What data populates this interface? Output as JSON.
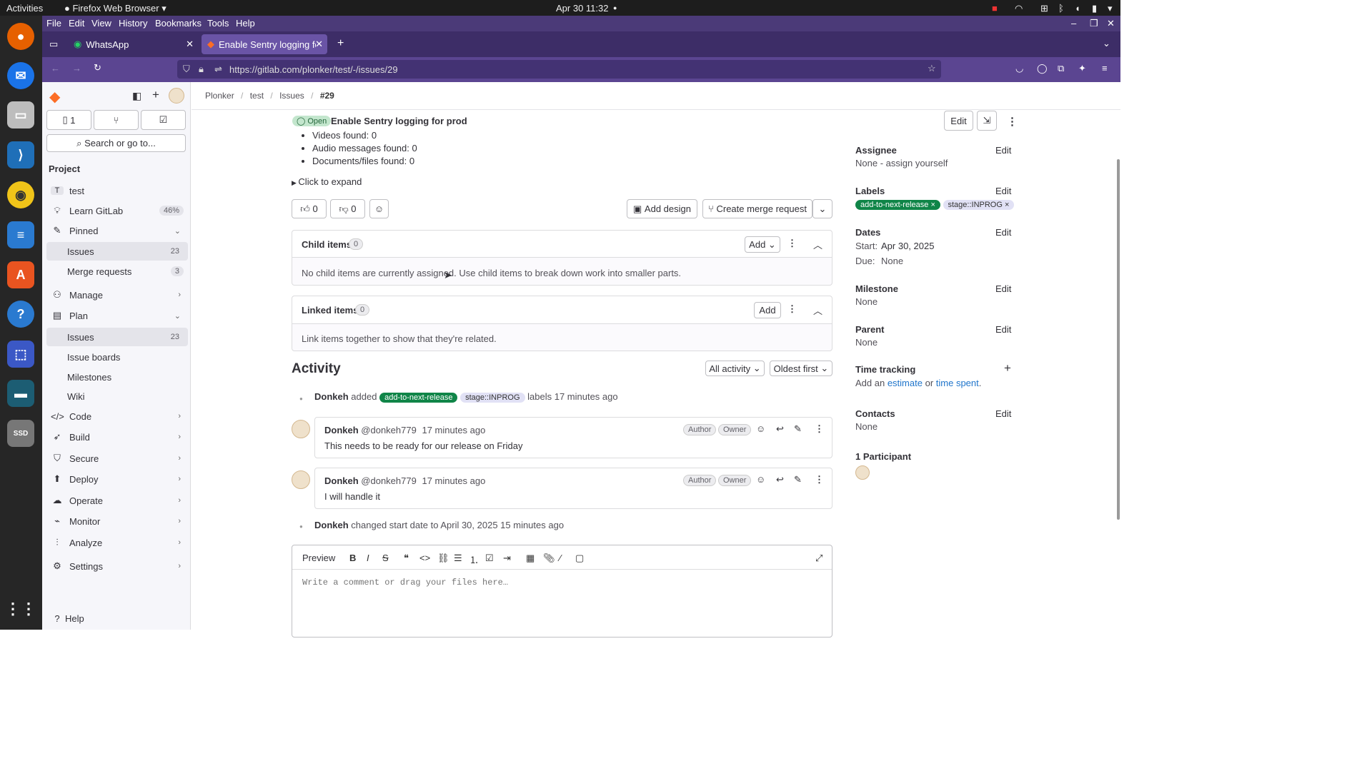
{
  "system": {
    "activities": "Activities",
    "app_name": "Firefox Web Browser",
    "clock": "Apr 30  11:32"
  },
  "dock": {
    "items": [
      "firefox-icon",
      "thunderbird-icon",
      "files-icon",
      "vscode-icon",
      "rhythmbox-icon",
      "writer-icon",
      "app-center-icon",
      "help-icon",
      "screenshot-icon",
      "terminal-icon",
      "ssd-icon",
      "app-grid-icon"
    ],
    "ssd_label": "SSD"
  },
  "firefox": {
    "menu": [
      "File",
      "Edit",
      "View",
      "History",
      "Bookmarks",
      "Tools",
      "Help"
    ],
    "tabs": [
      {
        "title": "WhatsApp"
      },
      {
        "title": "Enable Sentry logging for"
      }
    ],
    "url": "https://gitlab.com/plonker/test/-/issues/29"
  },
  "sidebar": {
    "todo_count": "1",
    "search_label": "Search or go to...",
    "section": "Project",
    "project_letter": "T",
    "project_name": "test",
    "learn_label": "Learn GitLab",
    "learn_progress": "46%",
    "pinned_label": "Pinned",
    "pinned_items": [
      {
        "label": "Issues",
        "count": "23"
      },
      {
        "label": "Merge requests",
        "count": "3"
      }
    ],
    "manage_label": "Manage",
    "plan_label": "Plan",
    "plan_items": [
      {
        "label": "Issues",
        "count": "23"
      },
      {
        "label": "Issue boards"
      },
      {
        "label": "Milestones"
      },
      {
        "label": "Wiki"
      }
    ],
    "groups": [
      "Code",
      "Build",
      "Secure",
      "Deploy",
      "Operate",
      "Monitor",
      "Analyze"
    ],
    "settings_label": "Settings",
    "help_label": "Help"
  },
  "breadcrumb": [
    "Plonker",
    "test",
    "Issues",
    "#29"
  ],
  "issue": {
    "status": "Open",
    "title": "Enable Sentry logging for prod",
    "edit_label": "Edit",
    "list_items": [
      "Videos found: 0",
      "Audio messages found: 0",
      "Documents/files found: 0"
    ],
    "expand_label": "Click to expand",
    "thumbs_up": "0",
    "thumbs_down": "0",
    "add_design": "Add design",
    "create_mr": "Create merge request"
  },
  "child_items": {
    "title": "Child items",
    "count": "0",
    "add": "Add",
    "empty": "No child items are currently assigned. Use child items to break down work into smaller parts."
  },
  "linked_items": {
    "title": "Linked items",
    "count": "0",
    "add": "Add",
    "empty": "Link items together to show that they're related."
  },
  "activity": {
    "title": "Activity",
    "filter": "All activity",
    "sort": "Oldest first",
    "event1": {
      "user": "Donkeh",
      "verb": "added",
      "label1": "add-to-next-release",
      "label2": "stage::INPROG",
      "tail": "labels 17 minutes ago"
    },
    "notes": [
      {
        "user": "Donkeh",
        "handle": "@donkeh779",
        "time": "17 minutes ago",
        "role1": "Author",
        "role2": "Owner",
        "body": "This needs to be ready for our release on Friday"
      },
      {
        "user": "Donkeh",
        "handle": "@donkeh779",
        "time": "17 minutes ago",
        "role1": "Author",
        "role2": "Owner",
        "body": "I will handle it"
      }
    ],
    "event2": {
      "user": "Donkeh",
      "text": "changed start date to April 30, 2025 15 minutes ago"
    }
  },
  "editor": {
    "preview": "Preview",
    "placeholder": "Write a comment or drag your files here…"
  },
  "right": {
    "edit": "Edit",
    "assignee_title": "Assignee",
    "assignee_value": "None - assign yourself",
    "labels_title": "Labels",
    "label1": "add-to-next-release",
    "label2": "stage::INPROG",
    "dates_title": "Dates",
    "start_label": "Start:",
    "start_value": "Apr 30, 2025",
    "due_label": "Due:",
    "due_value": "None",
    "milestone_title": "Milestone",
    "milestone_value": "None",
    "parent_title": "Parent",
    "parent_value": "None",
    "time_title": "Time tracking",
    "time_text1": "Add an",
    "time_link1": "estimate",
    "time_text2": "or",
    "time_link2": "time spent",
    "contacts_title": "Contacts",
    "contacts_value": "None",
    "participants_title": "1 Participant"
  }
}
